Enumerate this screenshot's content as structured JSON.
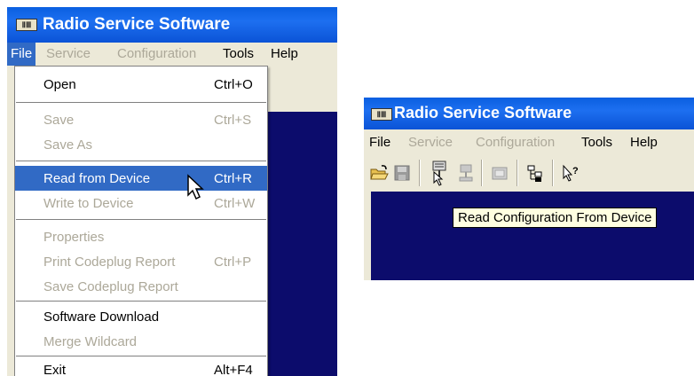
{
  "left_window": {
    "title": "Radio Service Software",
    "app_icon": "ⅡⅢ",
    "menu": [
      "File",
      "Service",
      "Configuration",
      "Tools",
      "Help"
    ],
    "file_menu": [
      {
        "label": "Open",
        "shortcut": "Ctrl+O",
        "enabled": true
      },
      {
        "label": "Save",
        "shortcut": "Ctrl+S",
        "enabled": false
      },
      {
        "label": "Save As",
        "shortcut": "",
        "enabled": false
      },
      {
        "label": "Read from Device",
        "shortcut": "Ctrl+R",
        "enabled": true,
        "highlighted": true
      },
      {
        "label": "Write to Device",
        "shortcut": "Ctrl+W",
        "enabled": false
      },
      {
        "label": "Properties",
        "shortcut": "",
        "enabled": false
      },
      {
        "label": "Print Codeplug Report",
        "shortcut": "Ctrl+P",
        "enabled": false
      },
      {
        "label": "Save Codeplug Report",
        "shortcut": "",
        "enabled": false
      },
      {
        "label": "Software Download",
        "shortcut": "",
        "enabled": true
      },
      {
        "label": "Merge Wildcard",
        "shortcut": "",
        "enabled": false
      },
      {
        "label": "Exit",
        "shortcut": "Alt+F4",
        "enabled": true
      }
    ]
  },
  "right_window": {
    "title": "Radio Service Software",
    "app_icon": "ⅡⅢ",
    "menu": [
      "File",
      "Service",
      "Configuration",
      "Tools",
      "Help"
    ],
    "toolbar_icons": [
      "open-folder-icon",
      "save-icon",
      "read-device-icon",
      "write-device-icon",
      "properties-icon",
      "hierarchy-icon",
      "help-pointer-icon"
    ],
    "tooltip": "Read Configuration From Device"
  },
  "colors": {
    "titlebar": "#0a5fe0",
    "menu_highlight": "#316ac5",
    "workspace": "#0c0c6c",
    "chrome": "#ece9d8",
    "disabled_text": "#aca899"
  }
}
